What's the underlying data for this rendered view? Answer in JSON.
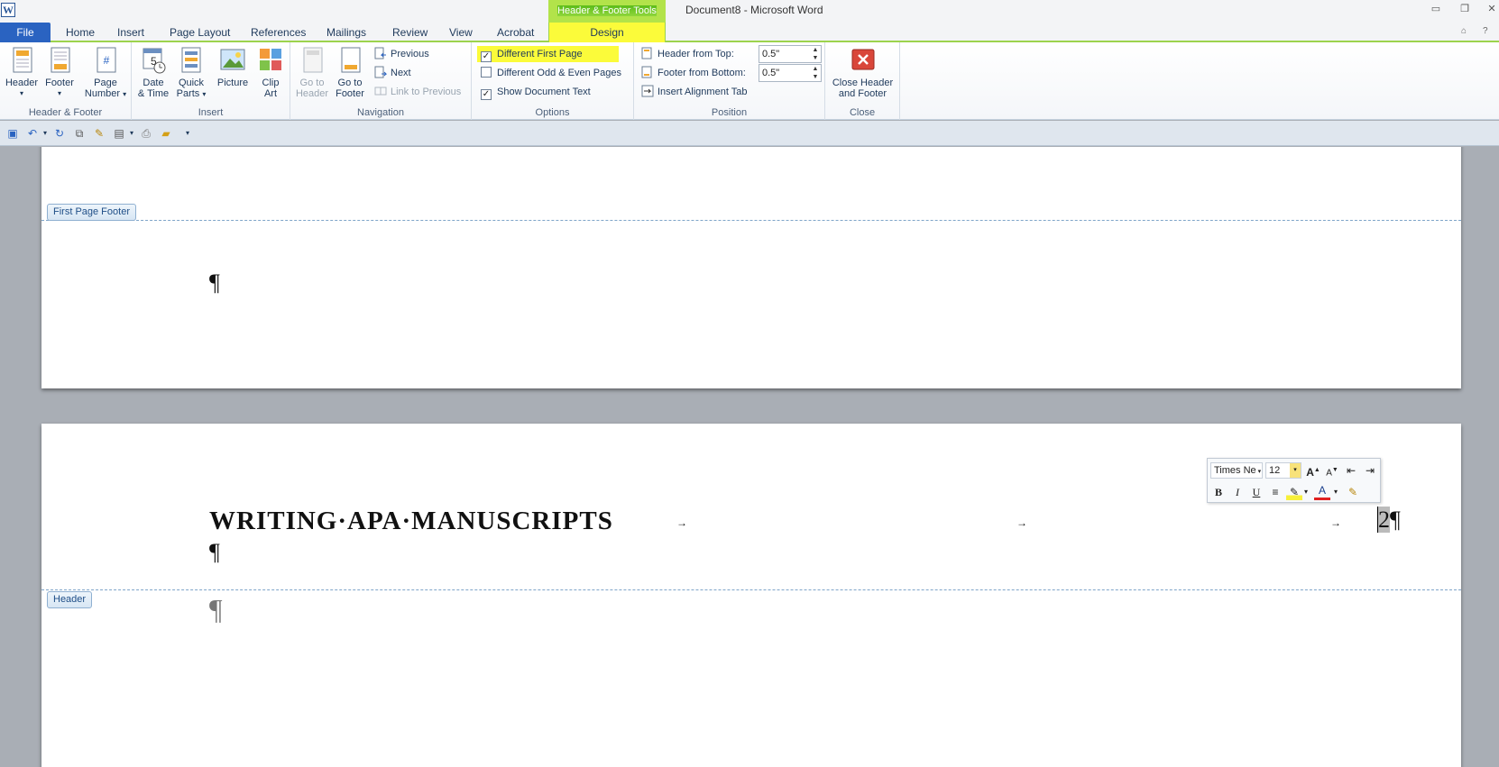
{
  "window": {
    "title": "Document8 - Microsoft Word",
    "app_icon_letter": "W",
    "context_group": "Header & Footer Tools"
  },
  "tabs": [
    "File",
    "Home",
    "Insert",
    "Page Layout",
    "References",
    "Mailings",
    "Review",
    "View",
    "Acrobat",
    "Design"
  ],
  "ribbon": {
    "header_footer": {
      "label": "Header & Footer",
      "header": "Header",
      "footer": "Footer",
      "page_number_1": "Page",
      "page_number_2": "Number"
    },
    "insert": {
      "label": "Insert",
      "date_time_1": "Date",
      "date_time_2": "& Time",
      "quick_parts_1": "Quick",
      "quick_parts_2": "Parts",
      "picture": "Picture",
      "clip_art_1": "Clip",
      "clip_art_2": "Art"
    },
    "navigation": {
      "label": "Navigation",
      "goto_header_1": "Go to",
      "goto_header_2": "Header",
      "goto_footer_1": "Go to",
      "goto_footer_2": "Footer",
      "previous": "Previous",
      "next": "Next",
      "link_to_previous": "Link to Previous"
    },
    "options": {
      "label": "Options",
      "different_first_page": "Different First Page",
      "different_first_page_checked": true,
      "different_odd_even": "Different Odd & Even Pages",
      "different_odd_even_checked": false,
      "show_document_text": "Show Document Text",
      "show_document_text_checked": true
    },
    "position": {
      "label": "Position",
      "header_from_top": "Header from Top:",
      "header_from_top_value": "0.5\"",
      "footer_from_bottom": "Footer from Bottom:",
      "footer_from_bottom_value": "0.5\"",
      "insert_alignment_tab": "Insert Alignment Tab"
    },
    "close": {
      "label": "Close",
      "close_1": "Close Header",
      "close_2": "and Footer"
    }
  },
  "document": {
    "first_page_footer_tag": "First Page Footer",
    "header_tag": "Header",
    "pilcrow": "¶",
    "running_head": "WRITING·APA·MANUSCRIPTS",
    "tab_arrow": "→",
    "page_number": "2"
  },
  "mini_toolbar": {
    "font": "Times Ne",
    "size": "12"
  },
  "colors": {
    "file_tab": "#2a63c1",
    "context_highlight": "#fbfb3a",
    "context_green": "#9cd34d"
  }
}
